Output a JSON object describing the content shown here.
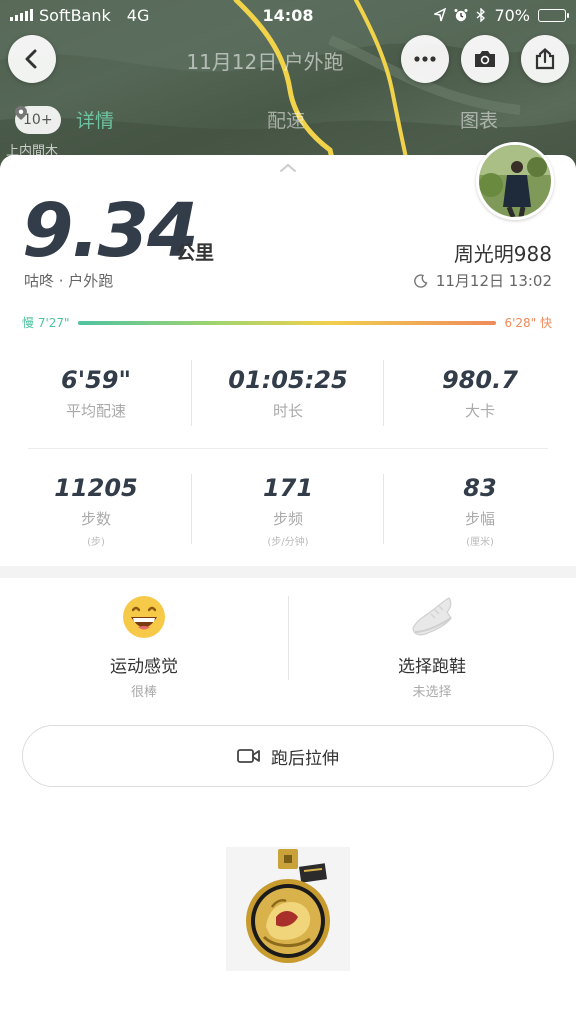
{
  "status_bar": {
    "carrier": "SoftBank",
    "network": "4G",
    "time": "14:08",
    "battery_percent": "70%",
    "battery_level": 0.7
  },
  "header": {
    "title": "11月12日 户外跑",
    "tabs": [
      {
        "label": "详情",
        "active": true
      },
      {
        "label": "配速",
        "active": false
      },
      {
        "label": "图表",
        "active": false
      }
    ],
    "map_zoom": "10+",
    "map_place": "上内間木"
  },
  "summary": {
    "distance": "9.34",
    "distance_unit": "公里",
    "device_type": "咕咚 · 户外跑",
    "username": "周光明988",
    "datetime": "11月12日 13:02",
    "pace_slow": "慢 7'27\"",
    "pace_fast": "6'28\" 快"
  },
  "stats": [
    {
      "value": "6'59\"",
      "label": "平均配速",
      "unit": ""
    },
    {
      "value": "01:05:25",
      "label": "时长",
      "unit": ""
    },
    {
      "value": "980.7",
      "label": "大卡",
      "unit": ""
    },
    {
      "value": "11205",
      "label": "步数",
      "unit": "(步)"
    },
    {
      "value": "171",
      "label": "步频",
      "unit": "(步/分钟)"
    },
    {
      "value": "83",
      "label": "步幅",
      "unit": "(厘米)"
    }
  ],
  "feelings": {
    "sport_feel_title": "运动感觉",
    "sport_feel_value": "很棒",
    "shoes_title": "选择跑鞋",
    "shoes_value": "未选择"
  },
  "stretch_button": "跑后拉伸",
  "colors": {
    "accent_green": "#4fc3a0",
    "accent_orange": "#ef8a5c",
    "route_yellow": "#f1d34a"
  }
}
